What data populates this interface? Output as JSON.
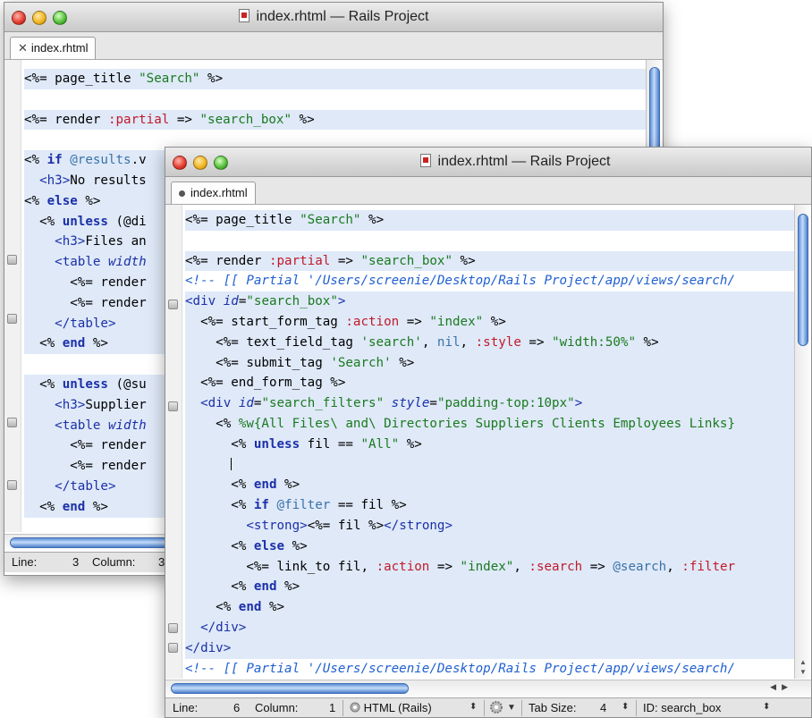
{
  "back_window": {
    "title": "index.rhtml — Rails Project",
    "tab": "index.rhtml",
    "lines": [
      {
        "hl": true,
        "tokens": [
          [
            "pun",
            "<%= "
          ],
          [
            "plain",
            "page_title "
          ],
          [
            "str",
            "\"Search\""
          ],
          [
            "pun",
            " %>"
          ]
        ]
      },
      {
        "hl": false,
        "tokens": []
      },
      {
        "hl": true,
        "tokens": [
          [
            "pun",
            "<%= "
          ],
          [
            "plain",
            "render "
          ],
          [
            "sym",
            ":partial"
          ],
          [
            "plain",
            " => "
          ],
          [
            "str",
            "\"search_box\""
          ],
          [
            "pun",
            " %>"
          ]
        ]
      },
      {
        "hl": false,
        "tokens": []
      },
      {
        "hl": true,
        "tokens": [
          [
            "pun",
            "<% "
          ],
          [
            "kw",
            "if "
          ],
          [
            "ivar",
            "@results"
          ],
          [
            "plain",
            ".v"
          ]
        ]
      },
      {
        "hl": true,
        "tokens": [
          [
            "plain",
            "  "
          ],
          [
            "tag",
            "<h3>"
          ],
          [
            "plain",
            "No results"
          ]
        ]
      },
      {
        "hl": true,
        "tokens": [
          [
            "pun",
            "<% "
          ],
          [
            "kw",
            "else"
          ],
          [
            "pun",
            " %>"
          ]
        ]
      },
      {
        "hl": true,
        "tokens": [
          [
            "plain",
            "  "
          ],
          [
            "pun",
            "<% "
          ],
          [
            "kw",
            "unless "
          ],
          [
            "plain",
            "(@di"
          ]
        ]
      },
      {
        "hl": true,
        "tokens": [
          [
            "plain",
            "    "
          ],
          [
            "tag",
            "<h3>"
          ],
          [
            "plain",
            "Files an"
          ]
        ]
      },
      {
        "hl": true,
        "tokens": [
          [
            "plain",
            "    "
          ],
          [
            "tag",
            "<table "
          ],
          [
            "attr",
            "width"
          ]
        ]
      },
      {
        "hl": true,
        "tokens": [
          [
            "plain",
            "      "
          ],
          [
            "pun",
            "<%= "
          ],
          [
            "plain",
            "render"
          ]
        ]
      },
      {
        "hl": true,
        "tokens": [
          [
            "plain",
            "      "
          ],
          [
            "pun",
            "<%= "
          ],
          [
            "plain",
            "render"
          ]
        ]
      },
      {
        "hl": true,
        "tokens": [
          [
            "plain",
            "    "
          ],
          [
            "tag",
            "</table>"
          ]
        ]
      },
      {
        "hl": true,
        "tokens": [
          [
            "plain",
            "  "
          ],
          [
            "pun",
            "<% "
          ],
          [
            "kw",
            "end"
          ],
          [
            "pun",
            " %>"
          ]
        ]
      },
      {
        "hl": false,
        "tokens": []
      },
      {
        "hl": true,
        "tokens": [
          [
            "plain",
            "  "
          ],
          [
            "pun",
            "<% "
          ],
          [
            "kw",
            "unless "
          ],
          [
            "plain",
            "(@su"
          ]
        ]
      },
      {
        "hl": true,
        "tokens": [
          [
            "plain",
            "    "
          ],
          [
            "tag",
            "<h3>"
          ],
          [
            "plain",
            "Supplier"
          ]
        ]
      },
      {
        "hl": true,
        "tokens": [
          [
            "plain",
            "    "
          ],
          [
            "tag",
            "<table "
          ],
          [
            "attr",
            "width"
          ]
        ]
      },
      {
        "hl": true,
        "tokens": [
          [
            "plain",
            "      "
          ],
          [
            "pun",
            "<%= "
          ],
          [
            "plain",
            "render"
          ]
        ]
      },
      {
        "hl": true,
        "tokens": [
          [
            "plain",
            "      "
          ],
          [
            "pun",
            "<%= "
          ],
          [
            "plain",
            "render"
          ]
        ]
      },
      {
        "hl": true,
        "tokens": [
          [
            "plain",
            "    "
          ],
          [
            "tag",
            "</table>"
          ]
        ]
      },
      {
        "hl": true,
        "tokens": [
          [
            "plain",
            "  "
          ],
          [
            "pun",
            "<% "
          ],
          [
            "kw",
            "end"
          ],
          [
            "pun",
            " %>"
          ]
        ]
      }
    ],
    "status": {
      "line_label": "Line:",
      "line_value": "3",
      "column_label": "Column:",
      "column_value": "3"
    }
  },
  "front_window": {
    "title": "index.rhtml — Rails Project",
    "tab": "index.rhtml",
    "lines": [
      {
        "hl": true,
        "tokens": [
          [
            "pun",
            "<%= "
          ],
          [
            "plain",
            "page_title "
          ],
          [
            "str",
            "\"Search\""
          ],
          [
            "pun",
            " %>"
          ]
        ]
      },
      {
        "hl": false,
        "tokens": []
      },
      {
        "hl": true,
        "tokens": [
          [
            "pun",
            "<%= "
          ],
          [
            "plain",
            "render "
          ],
          [
            "sym",
            ":partial"
          ],
          [
            "plain",
            " => "
          ],
          [
            "str",
            "\"search_box\""
          ],
          [
            "pun",
            " %>"
          ]
        ]
      },
      {
        "hl": false,
        "tokens": [
          [
            "cmt",
            "<!-- [[ Partial '/Users/screenie/Desktop/Rails Project/app/views/search/"
          ]
        ]
      },
      {
        "hl": true,
        "tokens": [
          [
            "tag",
            "<div "
          ],
          [
            "attr",
            "id"
          ],
          [
            "plain",
            "="
          ],
          [
            "str",
            "\"search_box\""
          ],
          [
            "tag",
            ">"
          ]
        ]
      },
      {
        "hl": true,
        "tokens": [
          [
            "plain",
            "  "
          ],
          [
            "pun",
            "<%= "
          ],
          [
            "plain",
            "start_form_tag "
          ],
          [
            "sym",
            ":action"
          ],
          [
            "plain",
            " => "
          ],
          [
            "str",
            "\"index\""
          ],
          [
            "pun",
            " %>"
          ]
        ]
      },
      {
        "hl": true,
        "tokens": [
          [
            "plain",
            "    "
          ],
          [
            "pun",
            "<%= "
          ],
          [
            "plain",
            "text_field_tag "
          ],
          [
            "str",
            "'search'"
          ],
          [
            "plain",
            ", "
          ],
          [
            "ivar",
            "nil"
          ],
          [
            "plain",
            ", "
          ],
          [
            "sym",
            ":style"
          ],
          [
            "plain",
            " => "
          ],
          [
            "str",
            "\"width:50%\""
          ],
          [
            "pun",
            " %>"
          ]
        ]
      },
      {
        "hl": true,
        "tokens": [
          [
            "plain",
            "    "
          ],
          [
            "pun",
            "<%= "
          ],
          [
            "plain",
            "submit_tag "
          ],
          [
            "str",
            "'Search'"
          ],
          [
            "pun",
            " %>"
          ]
        ]
      },
      {
        "hl": true,
        "tokens": [
          [
            "plain",
            "  "
          ],
          [
            "pun",
            "<%= "
          ],
          [
            "plain",
            "end_form_tag"
          ],
          [
            "pun",
            " %>"
          ]
        ]
      },
      {
        "hl": true,
        "tokens": [
          [
            "plain",
            "  "
          ],
          [
            "tag",
            "<div "
          ],
          [
            "attr",
            "id"
          ],
          [
            "plain",
            "="
          ],
          [
            "str",
            "\"search_filters\" "
          ],
          [
            "attr",
            "style"
          ],
          [
            "plain",
            "="
          ],
          [
            "str",
            "\"padding-top:10px\""
          ],
          [
            "tag",
            ">"
          ]
        ]
      },
      {
        "hl": true,
        "tokens": [
          [
            "plain",
            "    "
          ],
          [
            "pun",
            "<% "
          ],
          [
            "str",
            "%w{All Files\\ and\\ Directories Suppliers Clients Employees Links}"
          ]
        ]
      },
      {
        "hl": true,
        "tokens": [
          [
            "plain",
            "      "
          ],
          [
            "pun",
            "<% "
          ],
          [
            "kw",
            "unless "
          ],
          [
            "plain",
            "fil == "
          ],
          [
            "str",
            "\"All\""
          ],
          [
            "pun",
            " %>"
          ]
        ]
      },
      {
        "hl": true,
        "tokens": [
          [
            "plain",
            "      "
          ],
          [
            "caret",
            "|"
          ]
        ]
      },
      {
        "hl": true,
        "tokens": [
          [
            "plain",
            "      "
          ],
          [
            "pun",
            "<% "
          ],
          [
            "kw",
            "end"
          ],
          [
            "pun",
            " %>"
          ]
        ]
      },
      {
        "hl": true,
        "tokens": [
          [
            "plain",
            "      "
          ],
          [
            "pun",
            "<% "
          ],
          [
            "kw",
            "if "
          ],
          [
            "ivar",
            "@filter"
          ],
          [
            "plain",
            " == fil "
          ],
          [
            "pun",
            "%>"
          ]
        ]
      },
      {
        "hl": true,
        "tokens": [
          [
            "plain",
            "        "
          ],
          [
            "tag",
            "<strong>"
          ],
          [
            "pun",
            "<%= "
          ],
          [
            "plain",
            "fil "
          ],
          [
            "pun",
            "%>"
          ],
          [
            "tag",
            "</strong>"
          ]
        ]
      },
      {
        "hl": true,
        "tokens": [
          [
            "plain",
            "      "
          ],
          [
            "pun",
            "<% "
          ],
          [
            "kw",
            "else"
          ],
          [
            "pun",
            " %>"
          ]
        ]
      },
      {
        "hl": true,
        "tokens": [
          [
            "plain",
            "        "
          ],
          [
            "pun",
            "<%= "
          ],
          [
            "plain",
            "link_to fil, "
          ],
          [
            "sym",
            ":action"
          ],
          [
            "plain",
            " => "
          ],
          [
            "str",
            "\"index\""
          ],
          [
            "plain",
            ", "
          ],
          [
            "sym",
            ":search"
          ],
          [
            "plain",
            " => "
          ],
          [
            "ivar",
            "@search"
          ],
          [
            "plain",
            ", "
          ],
          [
            "sym",
            ":filter"
          ]
        ]
      },
      {
        "hl": true,
        "tokens": [
          [
            "plain",
            "      "
          ],
          [
            "pun",
            "<% "
          ],
          [
            "kw",
            "end"
          ],
          [
            "pun",
            " %>"
          ]
        ]
      },
      {
        "hl": true,
        "tokens": [
          [
            "plain",
            "    "
          ],
          [
            "pun",
            "<% "
          ],
          [
            "kw",
            "end"
          ],
          [
            "pun",
            " %>"
          ]
        ]
      },
      {
        "hl": true,
        "tokens": [
          [
            "plain",
            "  "
          ],
          [
            "tag",
            "</div>"
          ]
        ]
      },
      {
        "hl": true,
        "tokens": [
          [
            "tag",
            "</div>"
          ]
        ]
      },
      {
        "hl": false,
        "tokens": [
          [
            "cmt",
            "<!-- [[ Partial '/Users/screenie/Desktop/Rails Project/app/views/search/"
          ]
        ]
      }
    ],
    "status": {
      "line_label": "Line:",
      "line_value": "6",
      "column_label": "Column:",
      "column_value": "1",
      "language": "HTML (Rails)",
      "tab_size_label": "Tab Size:",
      "tab_size_value": "4",
      "symbol": "ID: search_box"
    }
  },
  "colors": {
    "selection": "#dfe9f8",
    "keyword": "#1b30a8",
    "symbol": "#c11a2a",
    "string": "#1a7a1f",
    "ivar": "#3a72a8",
    "comment": "#1f60d0",
    "scroll_thumb": "#5e8fd6"
  },
  "icons": {
    "close_button": "red-close-icon",
    "minimize_button": "yellow-minimize-icon",
    "zoom_button": "green-zoom-icon",
    "document": "rhtml-document-icon",
    "fold": "fold-marker-icon",
    "settings": "gear-icon"
  }
}
